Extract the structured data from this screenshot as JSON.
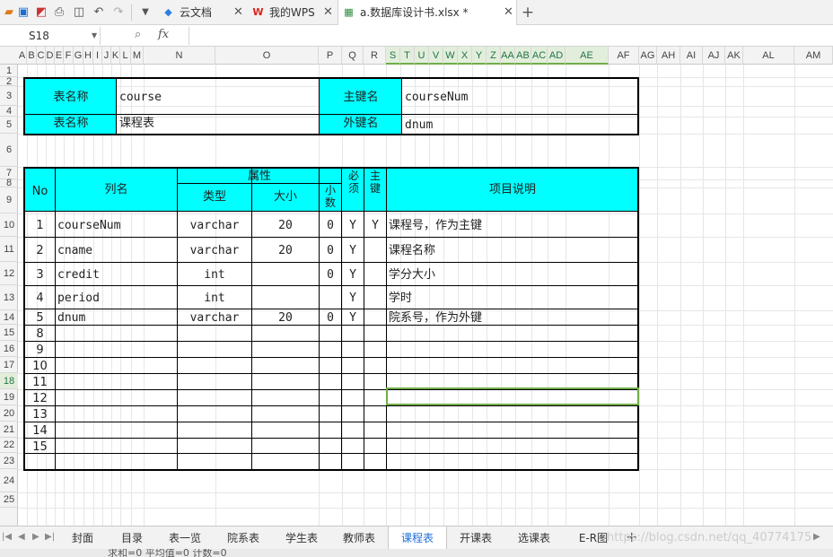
{
  "title_tabs": [
    {
      "label": "云文档"
    },
    {
      "label": "我的WPS"
    },
    {
      "label": "a.数据库设计书.xlsx *"
    }
  ],
  "formula_bar": {
    "cell_ref": "S18",
    "fx": "fx",
    "content": ""
  },
  "columns": [
    "A",
    "B",
    "C",
    "D",
    "E",
    "F",
    "G",
    "H",
    "I",
    "J",
    "K",
    "L",
    "M",
    "N",
    "O",
    "P",
    "Q",
    "R",
    "S",
    "T",
    "U",
    "V",
    "W",
    "X",
    "Y",
    "Z",
    "AA",
    "AB",
    "AC",
    "AD",
    "AE",
    "AF",
    "AG",
    "AH",
    "AI",
    "AJ",
    "AK",
    "AL",
    "AM"
  ],
  "rows": [
    "1",
    "2",
    "3",
    "4",
    "5",
    "6",
    "7",
    "8",
    "9",
    "10",
    "11",
    "12",
    "13",
    "14",
    "15",
    "16",
    "17",
    "18",
    "19",
    "20",
    "21",
    "22",
    "23",
    "24",
    "25"
  ],
  "header_block": {
    "table_name_label": "表名称",
    "table_name_value": "course",
    "pk_label": "主键名",
    "pk_value": "courseNum",
    "table_cn_label": "表名称",
    "table_cn_value": "课程表",
    "fk_label": "外键名",
    "fk_value": "dnum"
  },
  "column_headers": {
    "no": "No",
    "name": "列名",
    "attr": "属性",
    "type": "类型",
    "size": "大小",
    "decimal": "小数",
    "required": "必须",
    "primary": "主键",
    "desc": "项目说明"
  },
  "field_rows": [
    {
      "no": "1",
      "name": "courseNum",
      "type": "varchar",
      "size": "20",
      "decimal": "0",
      "required": "Y",
      "primary": "Y",
      "desc": "课程号，作为主键"
    },
    {
      "no": "2",
      "name": "cname",
      "type": "varchar",
      "size": "20",
      "decimal": "0",
      "required": "Y",
      "primary": "",
      "desc": "课程名称"
    },
    {
      "no": "3",
      "name": "credit",
      "type": "int",
      "size": "",
      "decimal": "0",
      "required": "Y",
      "primary": "",
      "desc": "学分大小"
    },
    {
      "no": "4",
      "name": "period",
      "type": "int",
      "size": "",
      "decimal": "",
      "required": "Y",
      "primary": "",
      "desc": "学时"
    },
    {
      "no": "5",
      "name": "dnum",
      "type": "varchar",
      "size": "20",
      "decimal": "0",
      "required": "Y",
      "primary": "",
      "desc": "院系号，作为外键"
    },
    {
      "no": "8",
      "name": "",
      "type": "",
      "size": "",
      "decimal": "",
      "required": "",
      "primary": "",
      "desc": ""
    },
    {
      "no": "9",
      "name": "",
      "type": "",
      "size": "",
      "decimal": "",
      "required": "",
      "primary": "",
      "desc": ""
    },
    {
      "no": "10",
      "name": "",
      "type": "",
      "size": "",
      "decimal": "",
      "required": "",
      "primary": "",
      "desc": ""
    },
    {
      "no": "11",
      "name": "",
      "type": "",
      "size": "",
      "decimal": "",
      "required": "",
      "primary": "",
      "desc": ""
    },
    {
      "no": "12",
      "name": "",
      "type": "",
      "size": "",
      "decimal": "",
      "required": "",
      "primary": "",
      "desc": ""
    },
    {
      "no": "13",
      "name": "",
      "type": "",
      "size": "",
      "decimal": "",
      "required": "",
      "primary": "",
      "desc": ""
    },
    {
      "no": "14",
      "name": "",
      "type": "",
      "size": "",
      "decimal": "",
      "required": "",
      "primary": "",
      "desc": ""
    },
    {
      "no": "15",
      "name": "",
      "type": "",
      "size": "",
      "decimal": "",
      "required": "",
      "primary": "",
      "desc": ""
    },
    {
      "no": "",
      "name": "",
      "type": "",
      "size": "",
      "decimal": "",
      "required": "",
      "primary": "",
      "desc": ""
    }
  ],
  "sheet_tabs": [
    "封面",
    "目录",
    "表一览",
    "院系表",
    "学生表",
    "教师表",
    "课程表",
    "开课表",
    "选课表",
    "E-R图"
  ],
  "active_sheet": "课程表",
  "status_text": "求和=0  平均值=0  计数=0",
  "watermark": "https://blog.csdn.net/qq_40774175",
  "colors": {
    "header_fill": "#00ffff",
    "selection": "#70ad47",
    "active_tab_text": "#1e6fd9"
  }
}
